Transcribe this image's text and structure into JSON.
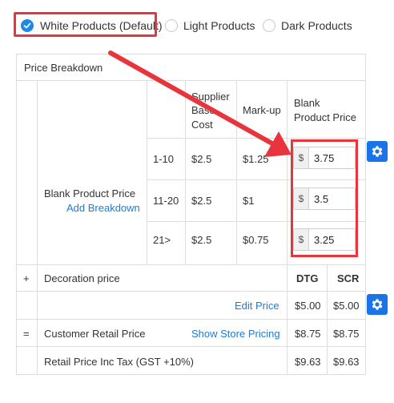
{
  "product_options": [
    {
      "label": "White Products (Default)",
      "selected": true
    },
    {
      "label": "Light Products",
      "selected": false
    },
    {
      "label": "Dark Products",
      "selected": false
    }
  ],
  "table": {
    "title": "Price Breakdown",
    "headers": {
      "supplier_cost": "Supplier Base Cost",
      "supplier_line1": "Supplier",
      "supplier_line2": "Base",
      "supplier_line3": "Cost",
      "markup": "Mark-up",
      "blank_line1": "Blank",
      "blank_line2": "Product Price"
    },
    "blank_product_label": "Blank Product Price",
    "add_breakdown": "Add Breakdown",
    "tiers": [
      {
        "range": "1-10",
        "cost": "$2.5",
        "markup": "$1.25",
        "currency": "$",
        "price": "3.75"
      },
      {
        "range": "11-20",
        "cost": "$2.5",
        "markup": "$1",
        "currency": "$",
        "price": "3.5"
      },
      {
        "range": "21>",
        "cost": "$2.5",
        "markup": "$0.75",
        "currency": "$",
        "price": "3.25"
      }
    ],
    "decoration": {
      "sign": "+",
      "label": "Decoration price",
      "col1": "DTG",
      "col2": "SCR",
      "edit_label": "Edit Price",
      "val1": "$5.00",
      "val2": "$5.00"
    },
    "retail": {
      "sign": "=",
      "label": "Customer Retail Price",
      "link": "Show Store Pricing",
      "val1": "$8.75",
      "val2": "$8.75"
    },
    "retail_tax": {
      "label": "Retail Price Inc Tax (GST +10%)",
      "val1": "$9.63",
      "val2": "$9.63"
    }
  },
  "colors": {
    "accent": "#1e88e5",
    "annotation": "#e8353d",
    "gear": "#1a73e8",
    "link": "#1e7bd6"
  }
}
